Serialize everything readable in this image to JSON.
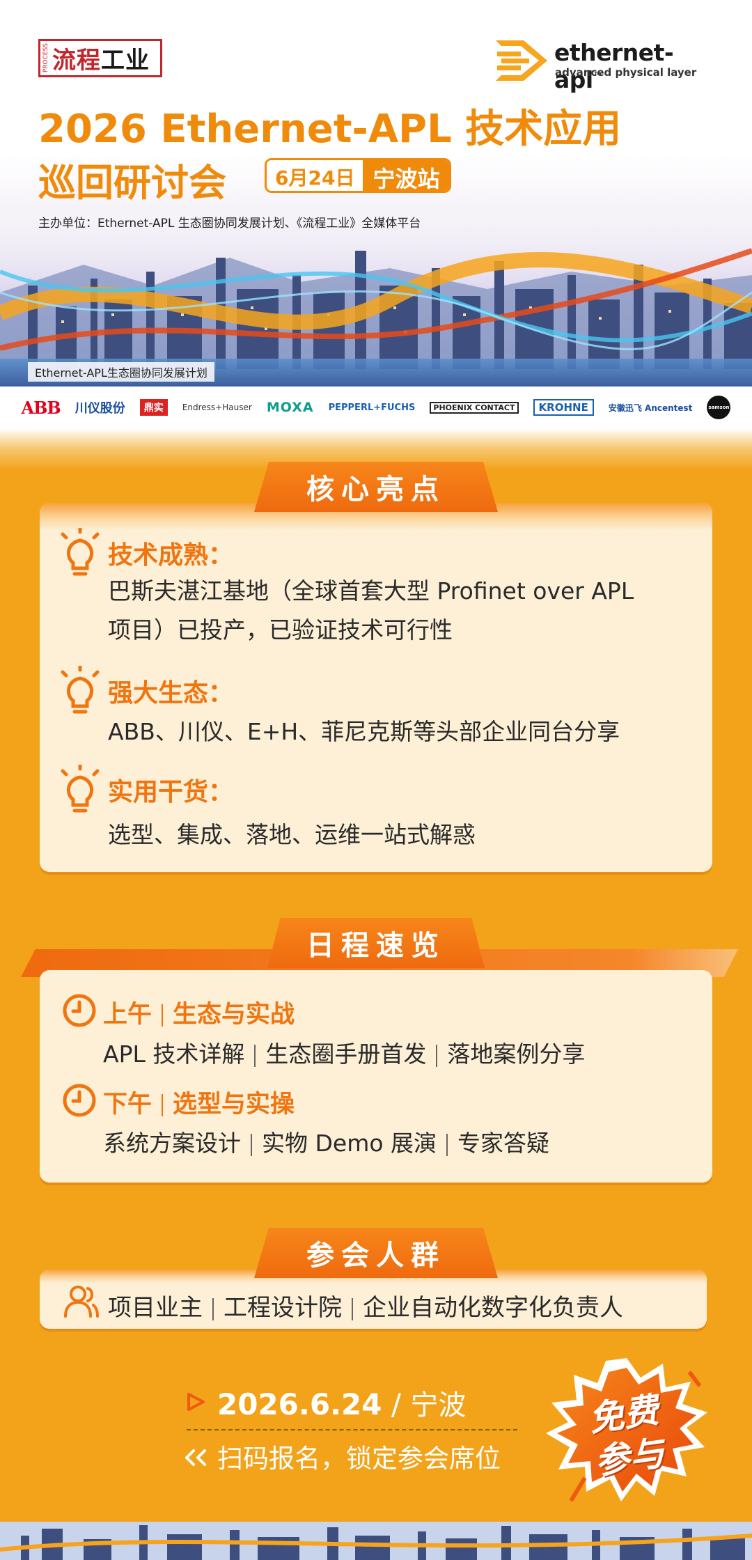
{
  "header": {
    "liucheng_logo_small": "PROCESS",
    "liucheng_logo_red": "流程",
    "liucheng_logo_black": "工业",
    "apl_logo_word": "ethernet-apl",
    "apl_logo_tm": "™",
    "apl_logo_sub": "advanced physical layer",
    "title_line1": "2026 Ethernet-APL 技术应用",
    "title_line2": "巡回研讨会",
    "date_chip": "6月24日",
    "city_chip": "宁波站",
    "host": "主办单位：Ethernet-APL 生态圈协同发展计划、《流程工业》全媒体平台",
    "footer_tag": "Ethernet-APL生态圈协同发展计划"
  },
  "partners": [
    "ABB",
    "川仪股份",
    "鼎实",
    "Endress+Hauser",
    "MOXA",
    "PEPPERL+FUCHS",
    "PHOENIX CONTACT",
    "KROHNE",
    "安徽迅飞 Ancentest",
    "samson"
  ],
  "highlights": {
    "title": "核心亮点",
    "items": [
      {
        "title": "技术成熟：",
        "lines": [
          "巴斯夫湛江基地（全球首套大型 Profinet over APL",
          "项目）已投产，已验证技术可行性"
        ]
      },
      {
        "title": "强大生态：",
        "lines": [
          "ABB、川仪、E+H、菲尼克斯等头部企业同台分享"
        ]
      },
      {
        "title": "实用干货：",
        "lines": [
          "选型、集成、落地、运维一站式解惑"
        ]
      }
    ]
  },
  "schedule": {
    "title": "日程速览",
    "items": [
      {
        "period": "上午",
        "theme": "生态与实战",
        "topics": [
          "APL 技术详解",
          "生态圈手册首发",
          "落地案例分享"
        ]
      },
      {
        "period": "下午",
        "theme": "选型与实操",
        "topics": [
          "系统方案设计",
          "实物 Demo 展演",
          "专家答疑"
        ]
      }
    ]
  },
  "audience": {
    "title": "参会人群",
    "groups": [
      "项目业主",
      "工程设计院",
      "企业自动化数字化负责人"
    ]
  },
  "footer": {
    "date": "2026.6.24",
    "slash": " / ",
    "city": "宁波",
    "cta": "扫码报名，锁定参会席位",
    "badge_line1": "免费",
    "badge_line2": "参与"
  },
  "colors": {
    "accent": "#ef7510",
    "background": "#f2a31a",
    "card": "#fdf0d6",
    "title": "#f08a0a"
  }
}
